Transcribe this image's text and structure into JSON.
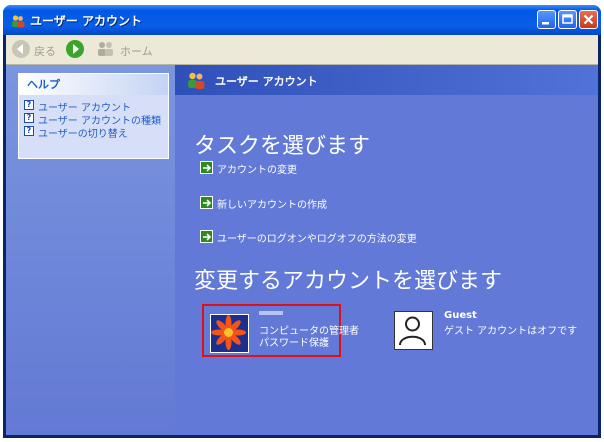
{
  "window": {
    "title": "ユーザー アカウント"
  },
  "toolbar": {
    "back_label": "戻る",
    "home_label": "ホーム"
  },
  "help": {
    "header": "ヘルプ",
    "items": [
      {
        "label": "ユーザー アカウント"
      },
      {
        "label": "ユーザー アカウントの種類"
      },
      {
        "label": "ユーザーの切り替え"
      }
    ]
  },
  "main": {
    "header": "ユーザー アカウント",
    "tasks_title": "タスクを選びます",
    "tasks": [
      {
        "label": "アカウントの変更"
      },
      {
        "label": "新しいアカウントの作成"
      },
      {
        "label": "ユーザーのログオンやログオフの方法の変更"
      }
    ],
    "accounts_title": "変更するアカウントを選びます",
    "accounts": [
      {
        "name": "",
        "line1": "コンピュータの管理者",
        "line2": "パスワード保護"
      },
      {
        "name": "Guest",
        "line1": "ゲスト アカウントはオフです"
      }
    ]
  },
  "colors": {
    "titlebar": "#0058e6",
    "content_bg": "#6279d8",
    "highlight_border": "#e0101a"
  }
}
